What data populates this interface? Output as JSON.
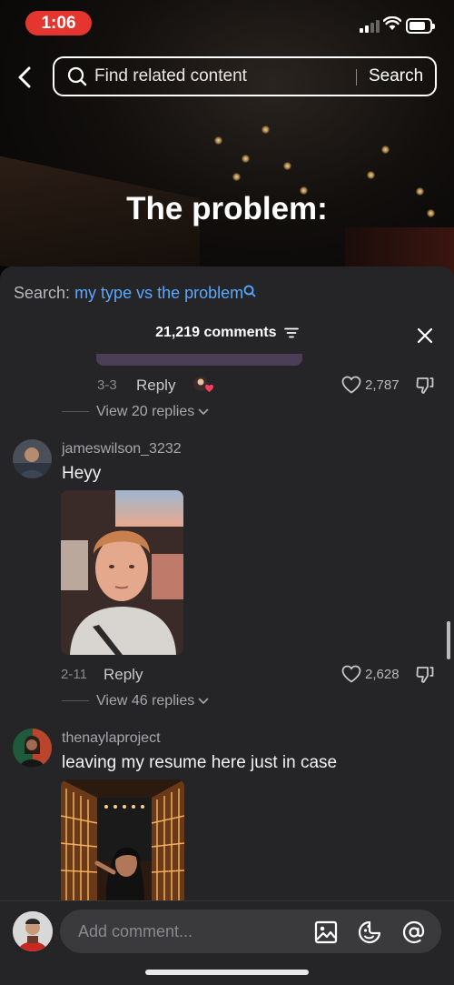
{
  "status_bar": {
    "time": "1:06"
  },
  "search": {
    "placeholder": "Find related content",
    "button_label": "Search"
  },
  "video": {
    "overlay_text": "The problem:"
  },
  "comments_panel": {
    "search_prefix": "Search:",
    "search_term": "my type vs the problem",
    "count_label": "21,219 comments"
  },
  "comments": [
    {
      "date": "3-3",
      "reply_label": "Reply",
      "likes": "2,787",
      "view_replies": "View 20 replies"
    },
    {
      "username": "jameswilson_3232",
      "text": "Heyy",
      "date": "2-11",
      "reply_label": "Reply",
      "likes": "2,628",
      "view_replies": "View 46 replies"
    },
    {
      "username": "thenaylaproject",
      "text": "leaving my resume here just in case"
    }
  ],
  "composer": {
    "placeholder": "Add comment..."
  },
  "colors": {
    "time_pill": "#e5352f",
    "sheet_bg": "#252527",
    "link_blue": "#5aa8ff",
    "like_heart": "#ff3b5c"
  },
  "icons": [
    "back-arrow-icon",
    "search-icon",
    "filter-icon",
    "close-icon",
    "heart-icon",
    "dislike-icon",
    "chevron-down-icon",
    "image-icon",
    "emoji-icon",
    "mention-icon"
  ]
}
